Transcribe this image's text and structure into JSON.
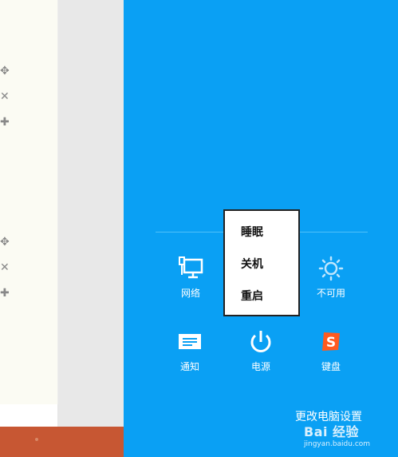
{
  "power_menu": {
    "items": [
      {
        "label": "睡眠"
      },
      {
        "label": "关机"
      },
      {
        "label": "重启"
      }
    ]
  },
  "quick_settings": {
    "network": {
      "label": "网络",
      "icon": "network-icon"
    },
    "power": {
      "label": "电源",
      "icon": "power-icon"
    },
    "brightness": {
      "label": "不可用",
      "icon": "brightness-icon"
    },
    "notifications": {
      "label": "通知",
      "icon": "notification-icon"
    },
    "keyboard": {
      "label": "键盘",
      "icon": "sogou-keyboard-icon"
    }
  },
  "change_pc_settings": "更改电脑设置",
  "watermark": {
    "logo_text": "Bai 经验",
    "url": "jingyan.baidu.com"
  },
  "colors": {
    "panel": "#0aa0f4",
    "taskbar": "#c75733",
    "keyboard_icon": "#ff5a1f"
  }
}
